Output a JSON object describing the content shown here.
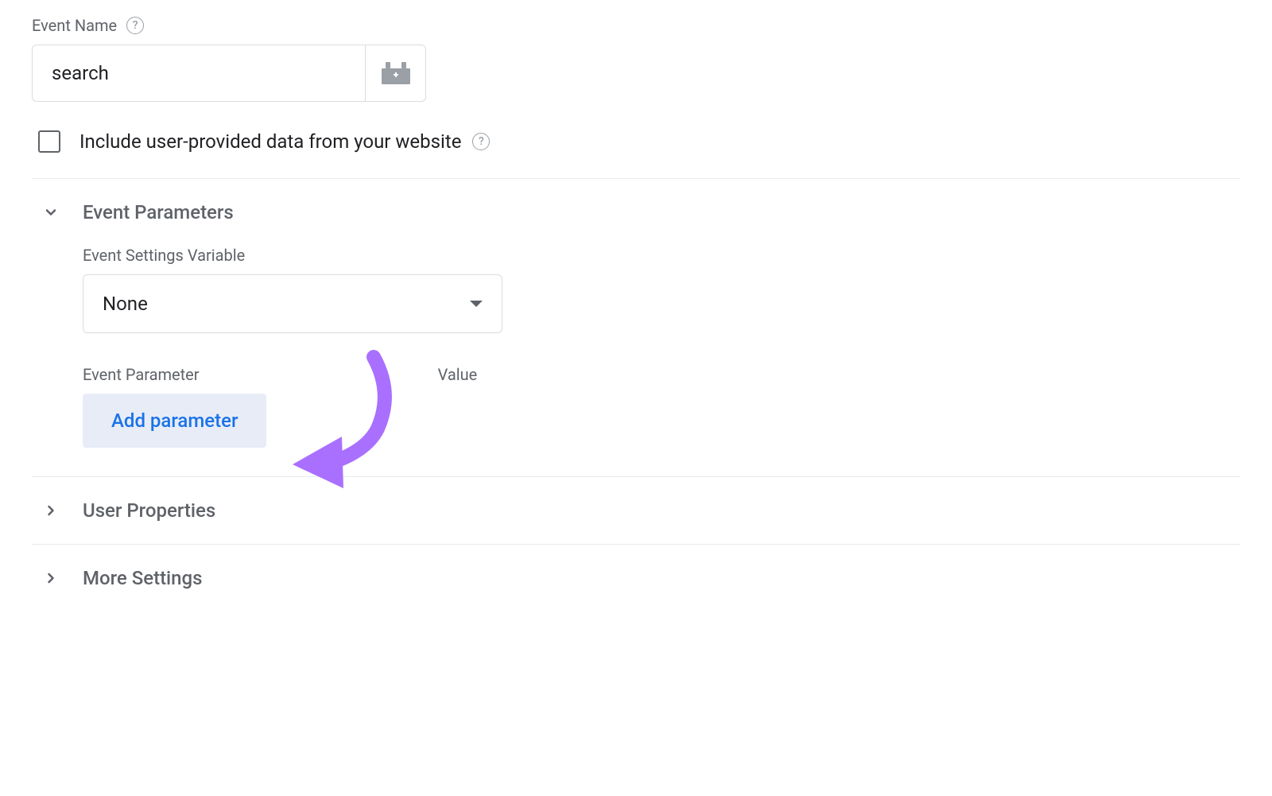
{
  "eventName": {
    "label": "Event Name",
    "value": "search"
  },
  "includeUserData": {
    "label": "Include user-provided data from your website",
    "checked": false
  },
  "sections": {
    "eventParameters": {
      "title": "Event Parameters",
      "expanded": true,
      "settingsVariable": {
        "label": "Event Settings Variable",
        "selected": "None"
      },
      "paramColLabel": "Event Parameter",
      "valueColLabel": "Value",
      "addParamLabel": "Add parameter"
    },
    "userProperties": {
      "title": "User Properties",
      "expanded": false
    },
    "moreSettings": {
      "title": "More Settings",
      "expanded": false
    }
  }
}
